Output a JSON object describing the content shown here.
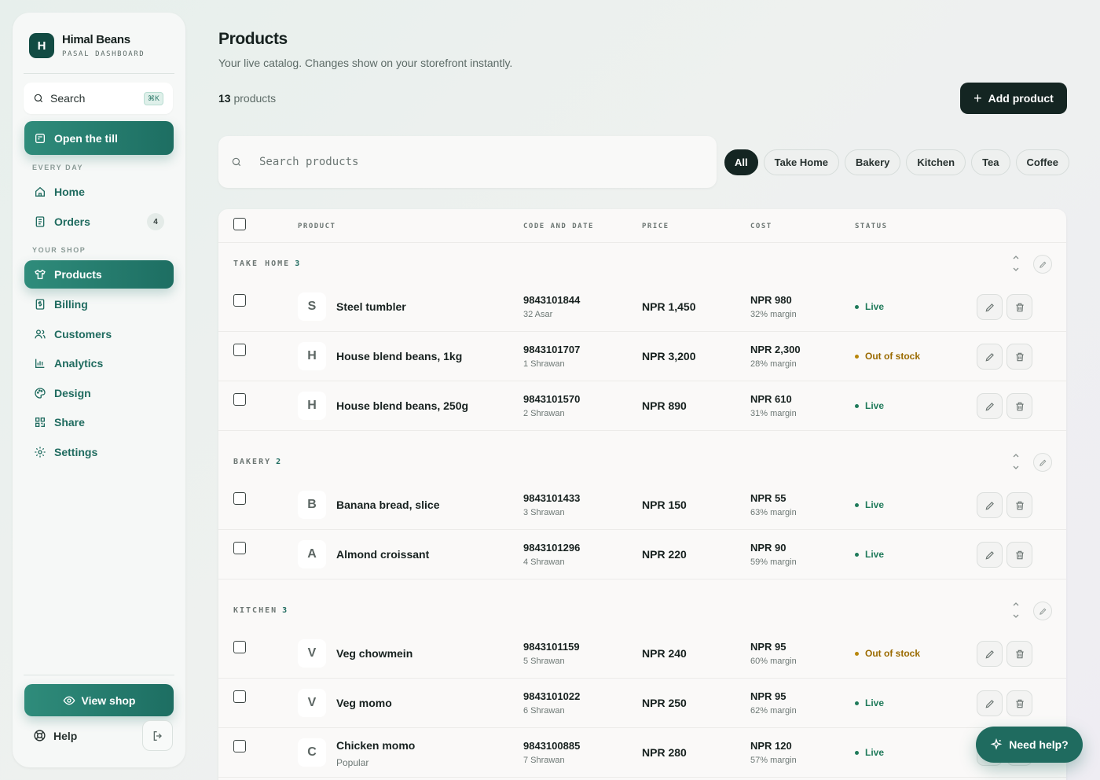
{
  "brand": {
    "logo_letter": "H",
    "name": "Himal Beans",
    "subtitle": "PASAL DASHBOARD"
  },
  "sidebar": {
    "search_label": "Search",
    "search_shortcut": "⌘K",
    "till_button": "Open the till",
    "section_everyday": "EVERY DAY",
    "section_shop": "YOUR SHOP",
    "items": [
      {
        "label": "Home",
        "icon": "home-icon"
      },
      {
        "label": "Orders",
        "icon": "receipt-icon",
        "badge": "4"
      },
      {
        "label": "Products",
        "icon": "shirt-icon",
        "active": true
      },
      {
        "label": "Billing",
        "icon": "bill-icon"
      },
      {
        "label": "Customers",
        "icon": "users-icon"
      },
      {
        "label": "Analytics",
        "icon": "bar-chart-icon"
      },
      {
        "label": "Design",
        "icon": "palette-icon"
      },
      {
        "label": "Share",
        "icon": "qr-icon"
      },
      {
        "label": "Settings",
        "icon": "gear-icon"
      }
    ],
    "view_shop": "View shop",
    "help": "Help"
  },
  "header": {
    "title": "Products",
    "subtitle": "Your live catalog. Changes show on your storefront instantly.",
    "count_number": "13",
    "count_label": "products",
    "add_button": "Add product"
  },
  "filters": {
    "search_placeholder": "Search products",
    "chips": [
      "All",
      "Take Home",
      "Bakery",
      "Kitchen",
      "Tea",
      "Coffee"
    ],
    "active_chip": "All"
  },
  "table": {
    "columns": [
      "PRODUCT",
      "CODE AND DATE",
      "PRICE",
      "COST",
      "STATUS"
    ],
    "groups": [
      {
        "name": "TAKE HOME",
        "count": "3",
        "rows": [
          {
            "letter": "S",
            "name": "Steel tumbler",
            "sub": "",
            "code": "9843101844",
            "date": "32 Asar",
            "price": "NPR 1,450",
            "cost": "NPR 980",
            "margin": "32% margin",
            "status": "Live"
          },
          {
            "letter": "H",
            "name": "House blend beans, 1kg",
            "sub": "",
            "code": "9843101707",
            "date": "1 Shrawan",
            "price": "NPR 3,200",
            "cost": "NPR 2,300",
            "margin": "28% margin",
            "status": "Out of stock"
          },
          {
            "letter": "H",
            "name": "House blend beans, 250g",
            "sub": "",
            "code": "9843101570",
            "date": "2 Shrawan",
            "price": "NPR 890",
            "cost": "NPR 610",
            "margin": "31% margin",
            "status": "Live"
          }
        ]
      },
      {
        "name": "BAKERY",
        "count": "2",
        "rows": [
          {
            "letter": "B",
            "name": "Banana bread, slice",
            "sub": "",
            "code": "9843101433",
            "date": "3 Shrawan",
            "price": "NPR 150",
            "cost": "NPR 55",
            "margin": "63% margin",
            "status": "Live"
          },
          {
            "letter": "A",
            "name": "Almond croissant",
            "sub": "",
            "code": "9843101296",
            "date": "4 Shrawan",
            "price": "NPR 220",
            "cost": "NPR 90",
            "margin": "59% margin",
            "status": "Live"
          }
        ]
      },
      {
        "name": "KITCHEN",
        "count": "3",
        "rows": [
          {
            "letter": "V",
            "name": "Veg chowmein",
            "sub": "",
            "code": "9843101159",
            "date": "5 Shrawan",
            "price": "NPR 240",
            "cost": "NPR 95",
            "margin": "60% margin",
            "status": "Out of stock"
          },
          {
            "letter": "V",
            "name": "Veg momo",
            "sub": "",
            "code": "9843101022",
            "date": "6 Shrawan",
            "price": "NPR 250",
            "cost": "NPR 95",
            "margin": "62% margin",
            "status": "Live"
          },
          {
            "letter": "C",
            "name": "Chicken momo",
            "sub": "Popular",
            "code": "9843100885",
            "date": "7 Shrawan",
            "price": "NPR 280",
            "cost": "NPR 120",
            "margin": "57% margin",
            "status": "Live"
          }
        ]
      }
    ]
  },
  "need_help": "Need help?",
  "colors": {
    "accent": "#1f6b5f",
    "dark": "#142522",
    "live": "#1f7a5a",
    "out_of_stock": "#9a6a00"
  }
}
